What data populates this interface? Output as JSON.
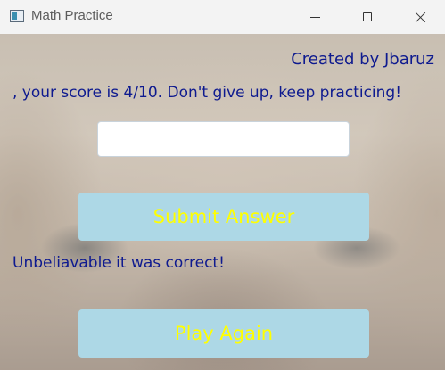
{
  "window": {
    "title": "Math Practice",
    "icon": "app-window-icon"
  },
  "header": {
    "credit": "Created by Jbaruz",
    "score_message": ", your score is 4/10. Don't give up, keep practicing!"
  },
  "answer_input": {
    "value": "",
    "placeholder": ""
  },
  "buttons": {
    "submit_label": "Submit Answer",
    "play_again_label": "Play Again"
  },
  "feedback": {
    "message": "Unbeliavable  it was correct!"
  },
  "colors": {
    "text": "#0e1a8f",
    "button_bg": "#add8e6",
    "button_text": "#ffff00"
  }
}
